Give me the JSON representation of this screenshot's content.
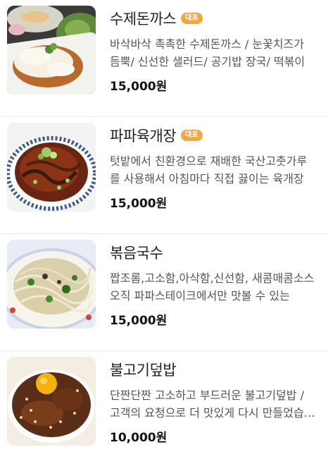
{
  "menu": {
    "items": [
      {
        "name": "수제돈까스",
        "badge": "대표",
        "description": "바삭바삭 촉촉한 수제돈까스 / 눈꽃치즈가 듬뿍/ 신선한 샐러드/ 공기밥 장국/ 떡볶이",
        "price": "15,000원",
        "image": "donkatsu-photo"
      },
      {
        "name": "파파육개장",
        "badge": "대표",
        "description": "텃밭에서 친환경으로 재배한 국산고춧가루를 사용해서 아침마다 직접 끓이는 육개장",
        "price": "15,000원",
        "image": "yukgaejang-photo"
      },
      {
        "name": "볶음국수",
        "badge": "",
        "description": "짭조롬,고소함,아삭함,신선함, 새콤매콤소스 오직 파파스테이크에서만 맛볼 수 있는",
        "price": "15,000원",
        "image": "stir-fried-noodles-photo"
      },
      {
        "name": "불고기덮밥",
        "badge": "",
        "description": "단짠단짠 고소하고 부드러운 불고기덮밥 / 고객의 요청으로 더 맛있게 다시 만들었습니다",
        "price": "10,000원",
        "image": "bulgogi-rice-bowl-photo"
      }
    ]
  }
}
